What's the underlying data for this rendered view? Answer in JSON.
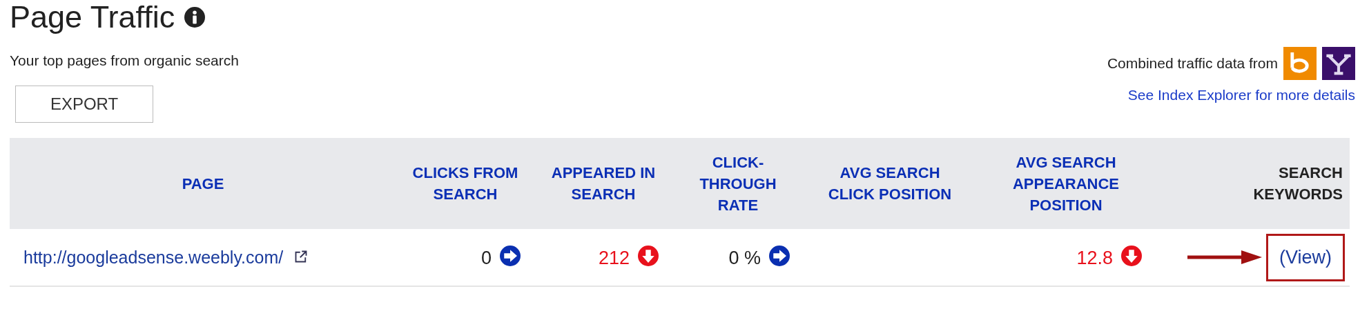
{
  "title": "Page Traffic",
  "subtitle": "Your top pages from organic search",
  "export_button": "EXPORT",
  "sources": {
    "label": "Combined traffic data from",
    "link": "See Index Explorer for more details"
  },
  "table": {
    "columns": [
      {
        "label": "PAGE",
        "kind": "sortable"
      },
      {
        "label": "CLICKS FROM SEARCH",
        "kind": "sortable"
      },
      {
        "label": "APPEARED IN SEARCH",
        "kind": "sortable"
      },
      {
        "label": "CLICK-THROUGH RATE",
        "kind": "sortable"
      },
      {
        "label": "AVG SEARCH CLICK POSITION",
        "kind": "sortable"
      },
      {
        "label": "AVG SEARCH APPEARANCE POSITION",
        "kind": "sortable"
      },
      {
        "label": "SEARCH KEYWORDS",
        "kind": "plain"
      }
    ],
    "rows": [
      {
        "page": "http://googleadsense.weebly.com/",
        "clicks": {
          "value": "0",
          "falling": false
        },
        "appeared": {
          "value": "212",
          "falling": true
        },
        "ctr": {
          "value": "0 %",
          "falling": false
        },
        "avg_appearance_position": {
          "value": "12.8",
          "falling": true
        },
        "keywords": {
          "link": "(View)",
          "highlighted": true
        }
      }
    ]
  }
}
